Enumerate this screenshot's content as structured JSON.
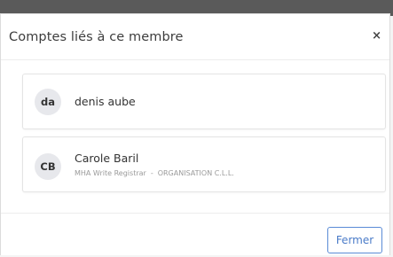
{
  "modal": {
    "title": "Comptes liés à ce membre",
    "close_glyph": "×",
    "close_icon": "close-icon"
  },
  "accounts": [
    {
      "initials": "da",
      "name": "denis aube"
    },
    {
      "initials": "CB",
      "name": "Carole Baril",
      "role": "MHA Write Registrar",
      "separator": "-",
      "organisation": "ORGANISATION C.L.L."
    }
  ],
  "footer": {
    "close_label": "Fermer"
  },
  "colors": {
    "accent": "#4a7bc8",
    "avatar_bg": "#e7e8ec"
  }
}
